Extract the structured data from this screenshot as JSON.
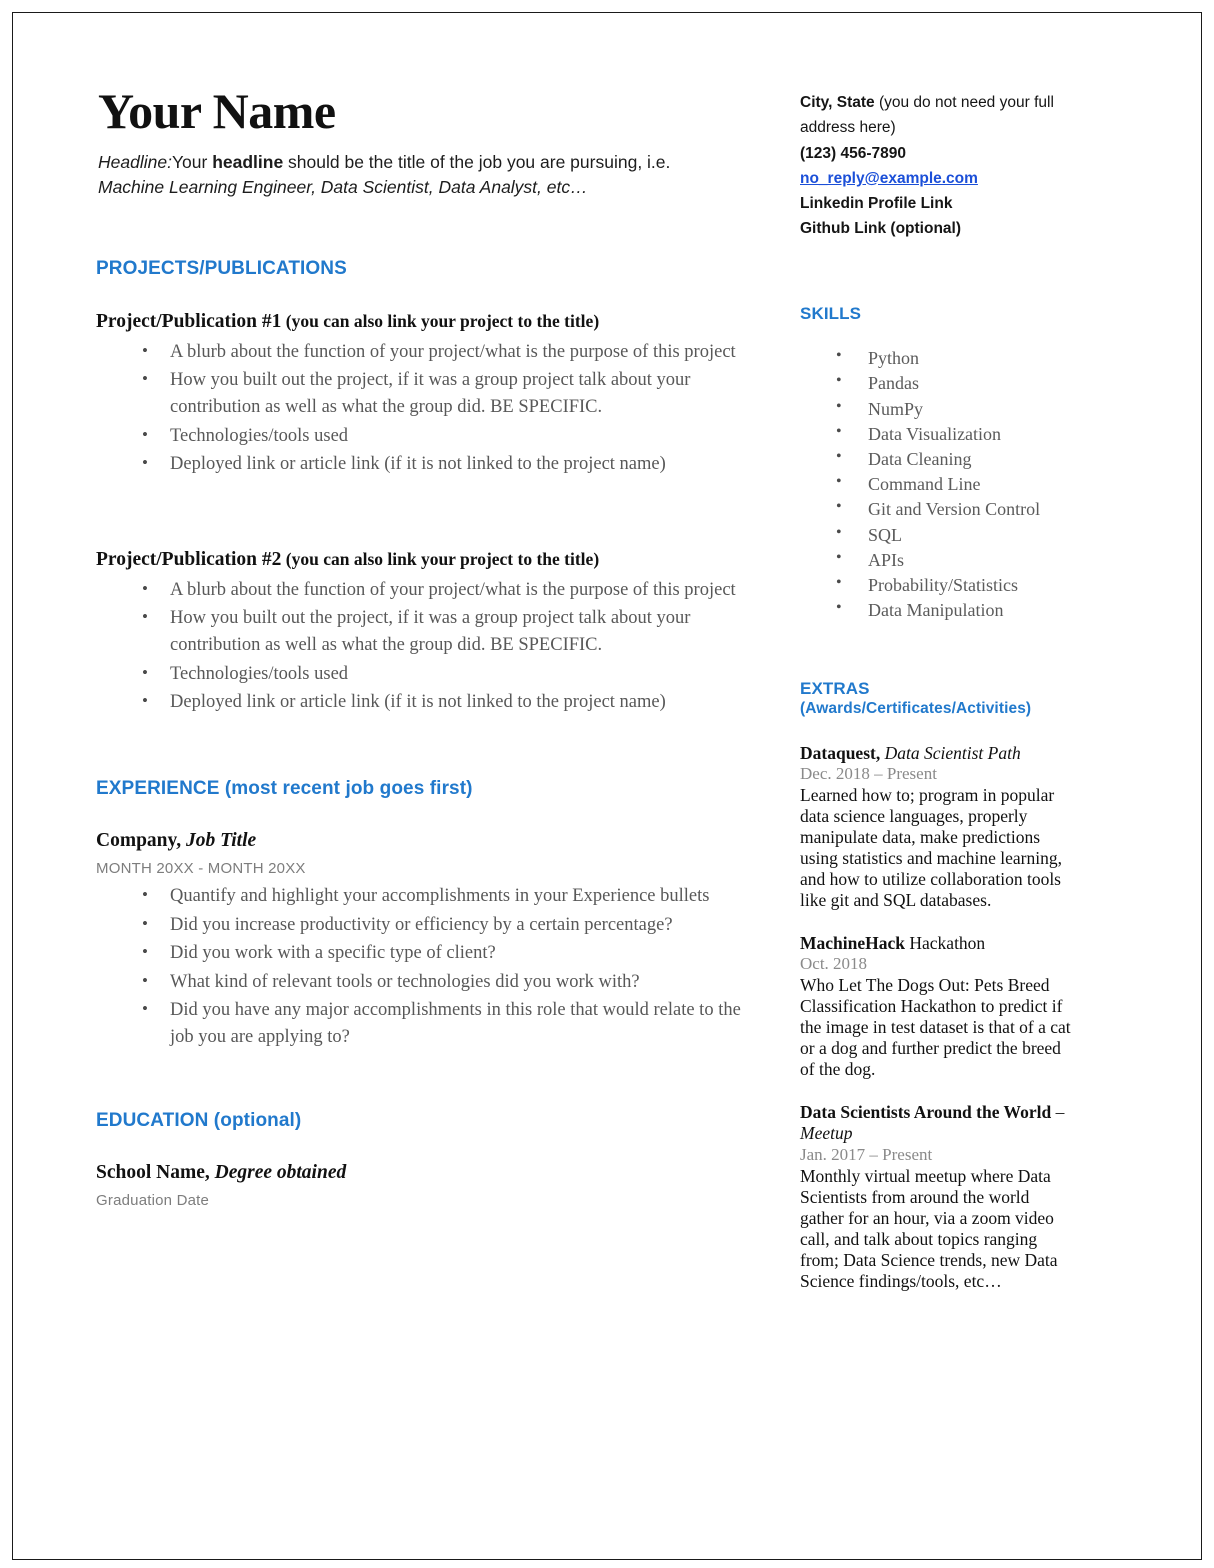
{
  "document": {
    "type": "resume-template",
    "accent_color": "#2179cc",
    "link_color": "#1b4fd8",
    "body_text_color": "#585858",
    "heading_text_color": "#111111"
  },
  "header": {
    "name": "Your Name",
    "headline_label": "Headline:",
    "headline_text_1": "Your ",
    "headline_bold": "headline",
    "headline_text_2": " should be the title of the job you are pursuing, i.e.",
    "headline_examples": "Machine Learning Engineer, Data Scientist, Data Analyst, etc…"
  },
  "contact": {
    "city_state_bold": "City, State",
    "city_state_note": " (you do not need your full address here)",
    "phone": "(123) 456-7890",
    "email": "no_reply@example.com",
    "linkedin": "Linkedin Profile Link",
    "github": "Github Link (optional)"
  },
  "projects_section": {
    "heading": "PROJECTS/PUBLICATIONS",
    "items": [
      {
        "title_main": "Project/Publication #1",
        "title_sub": " (you can also link your project to the title)",
        "bullets": [
          "A blurb about the function of your project/what is the purpose of this project",
          "How you built out the project, if it was a group project talk about your contribution as well as what the group did. BE SPECIFIC.",
          "Technologies/tools used",
          "Deployed link or article link (if it is not linked to the project name)"
        ]
      },
      {
        "title_main": "Project/Publication #2",
        "title_sub": " (you can also link your project to the title)",
        "bullets": [
          "A blurb about the function of your project/what is the purpose of this project",
          "How you built out the project, if it was a group project talk about your contribution as well as what the group did. BE SPECIFIC.",
          "Technologies/tools used",
          "Deployed link or article link (if it is not linked to the project name)"
        ]
      }
    ]
  },
  "experience_section": {
    "heading": "EXPERIENCE (most recent job goes first)",
    "entry": {
      "company": "Company,",
      "job_title": " Job Title",
      "dates": "MONTH 20XX - MONTH 20XX",
      "bullets": [
        "Quantify and highlight your accomplishments in your Experience bullets",
        "Did you increase productivity or efficiency by a certain percentage?",
        "Did you work with a specific type of client?",
        "What kind of relevant tools or technologies did you work with?",
        "Did you have any major accomplishments in this role that would relate to the job you are applying to?"
      ]
    }
  },
  "education_section": {
    "heading": "EDUCATION (optional)",
    "entry": {
      "school": "School Name,",
      "degree": " Degree obtained",
      "graduation": "Graduation Date"
    }
  },
  "skills_section": {
    "heading": "SKILLS",
    "items": [
      "Python",
      "Pandas",
      "NumPy",
      "Data Visualization",
      "Data Cleaning",
      "Command Line",
      "Git and Version Control",
      "SQL",
      "APIs",
      "Probability/Statistics",
      "Data Manipulation"
    ]
  },
  "extras_section": {
    "heading": "EXTRAS",
    "heading_sub": "(Awards/Certificates/Activities)",
    "items": [
      {
        "title_bold": "Dataquest,",
        "title_italic": " Data Scientist Path",
        "title_regular": "",
        "date": "Dec. 2018 – Present",
        "body": "Learned how to; program in popular data science languages, properly manipulate data, make predictions using statistics and machine learning, and how to utilize collaboration tools like git and SQL databases."
      },
      {
        "title_bold": "MachineHack",
        "title_italic": "",
        "title_regular": "  Hackathon",
        "date": "Oct. 2018",
        "body": "Who Let The Dogs Out: Pets Breed Classification Hackathon to predict if the image in test dataset is that of a cat or a dog and further predict the breed of the dog."
      },
      {
        "title_bold": "Data Scientists Around the World",
        "title_italic": " Meetup",
        "title_regular": " –",
        "date": "Jan. 2017 – Present",
        "body": "Monthly virtual meetup where Data Scientists from around the world gather for an hour, via a zoom video call, and talk about topics ranging from; Data Science trends, new Data Science findings/tools, etc…"
      }
    ]
  }
}
